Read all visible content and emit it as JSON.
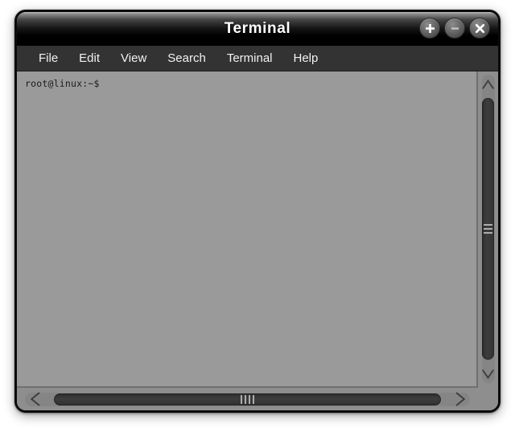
{
  "window": {
    "title": "Terminal",
    "frame_color": "#0b0b0b",
    "titlebar_color": "#000000",
    "buttons": [
      {
        "name": "maximize",
        "glyph": "+",
        "tooltip": "Maximize"
      },
      {
        "name": "minimize",
        "glyph": "–",
        "tooltip": "Minimize"
      },
      {
        "name": "close",
        "glyph": "✕",
        "tooltip": "Close"
      }
    ]
  },
  "menubar": {
    "background": "#333333",
    "items": [
      {
        "label": "File"
      },
      {
        "label": "Edit"
      },
      {
        "label": "View"
      },
      {
        "label": "Search"
      },
      {
        "label": "Terminal"
      },
      {
        "label": "Help"
      }
    ]
  },
  "terminal": {
    "background": "#9a9a9a",
    "foreground": "#1a1a1a",
    "lines": [
      "root@linux:~$"
    ],
    "prompt": "root@linux:~$",
    "user": "root",
    "host": "linux",
    "cwd": "~"
  },
  "scrollbars": {
    "vertical": {
      "up_arrow_icon": "chevron-up-icon",
      "down_arrow_icon": "chevron-down-icon",
      "thumb_grip_lines": 3,
      "track_color": "#858585",
      "thumb_color": "#343434"
    },
    "horizontal": {
      "left_arrow_icon": "chevron-left-icon",
      "right_arrow_icon": "chevron-right-icon",
      "thumb_grip_lines": 4,
      "track_color": "#858585",
      "thumb_color": "#303030"
    }
  }
}
